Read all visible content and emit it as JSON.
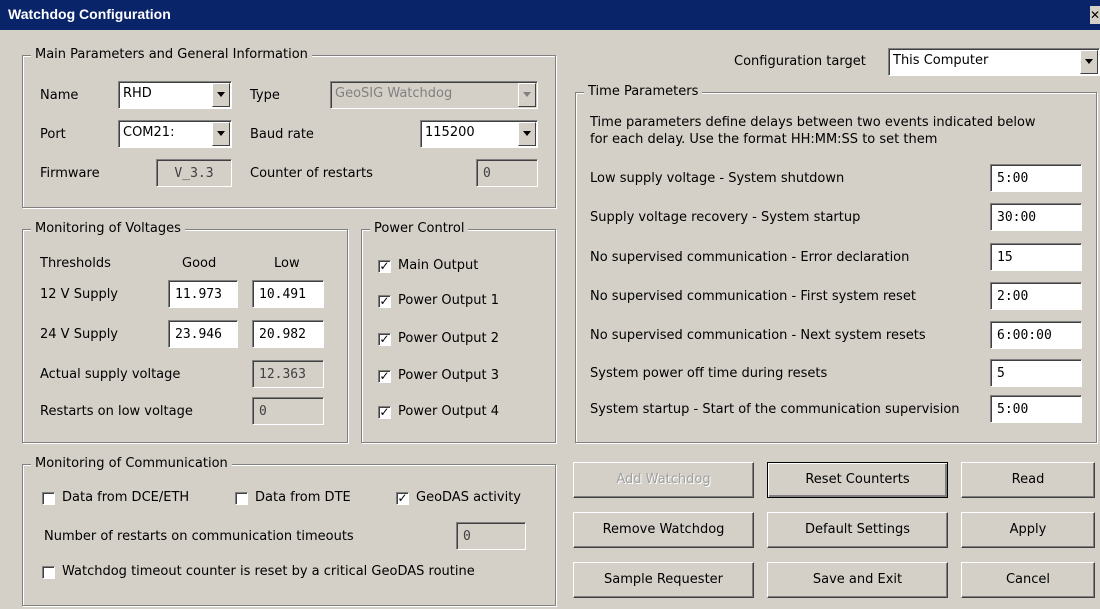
{
  "window": {
    "title": "Watchdog Configuration",
    "close_icon": "close-icon"
  },
  "main_params": {
    "legend": "Main Parameters and General Information",
    "name_label": "Name",
    "name_value": "RHD",
    "type_label": "Type",
    "type_value": "GeoSIG Watchdog",
    "port_label": "Port",
    "port_value": "COM21:",
    "baud_label": "Baud rate",
    "baud_value": "115200",
    "firmware_label": "Firmware",
    "firmware_value": "V_3.3",
    "restarts_label": "Counter of restarts",
    "restarts_value": "0"
  },
  "voltages": {
    "legend": "Monitoring of Voltages",
    "thresholds_label": "Thresholds",
    "good_label": "Good",
    "low_label": "Low",
    "supply12_label": "12 V Supply",
    "supply12_good": "11.973",
    "supply12_low": "10.491",
    "supply24_label": "24 V Supply",
    "supply24_good": "23.946",
    "supply24_low": "20.982",
    "actual_label": "Actual supply voltage",
    "actual_value": "12.363",
    "restarts_low_label": "Restarts on low voltage",
    "restarts_low_value": "0"
  },
  "power": {
    "legend": "Power Control",
    "items": [
      {
        "label": "Main Output",
        "checked": true
      },
      {
        "label": "Power Output 1",
        "checked": true
      },
      {
        "label": "Power Output 2",
        "checked": true
      },
      {
        "label": "Power Output 3",
        "checked": true
      },
      {
        "label": "Power Output 4",
        "checked": true
      }
    ]
  },
  "communication": {
    "legend": "Monitoring of Communication",
    "dce_label": "Data from DCE/ETH",
    "dce_checked": false,
    "dte_label": "Data from DTE",
    "dte_checked": false,
    "geodas_label": "GeoDAS activity",
    "geodas_checked": true,
    "timeouts_label": "Number of restarts on communication timeouts",
    "timeouts_value": "0",
    "critical_label": "Watchdog timeout counter is reset by a critical GeoDAS routine",
    "critical_checked": false
  },
  "config_target": {
    "label": "Configuration target",
    "value": "This Computer"
  },
  "time_params": {
    "legend": "Time Parameters",
    "desc_line1": "Time parameters define delays between two events indicated below",
    "desc_line2": "for each delay. Use the format HH:MM:SS to set them",
    "rows": [
      {
        "label": "Low supply voltage - System shutdown",
        "value": "5:00"
      },
      {
        "label": "Supply voltage recovery - System startup",
        "value": "30:00"
      },
      {
        "label": "No supervised communication - Error declaration",
        "value": "15"
      },
      {
        "label": "No supervised communication - First system reset",
        "value": "2:00"
      },
      {
        "label": "No supervised communication - Next system resets",
        "value": "6:00:00"
      },
      {
        "label": "System power off time during resets",
        "value": "5"
      },
      {
        "label": "System startup - Start of the communication supervision",
        "value": "5:00"
      }
    ]
  },
  "buttons": {
    "add_watchdog": "Add Watchdog",
    "reset_counters": "Reset Counterts",
    "read": "Read",
    "remove_watchdog": "Remove Watchdog",
    "default_settings": "Default Settings",
    "apply": "Apply",
    "sample_requester": "Sample Requester",
    "save_exit": "Save and Exit",
    "cancel": "Cancel"
  },
  "colors": {
    "title_bar": "#0a246a",
    "dialog_bg": "#d4d0c8"
  }
}
